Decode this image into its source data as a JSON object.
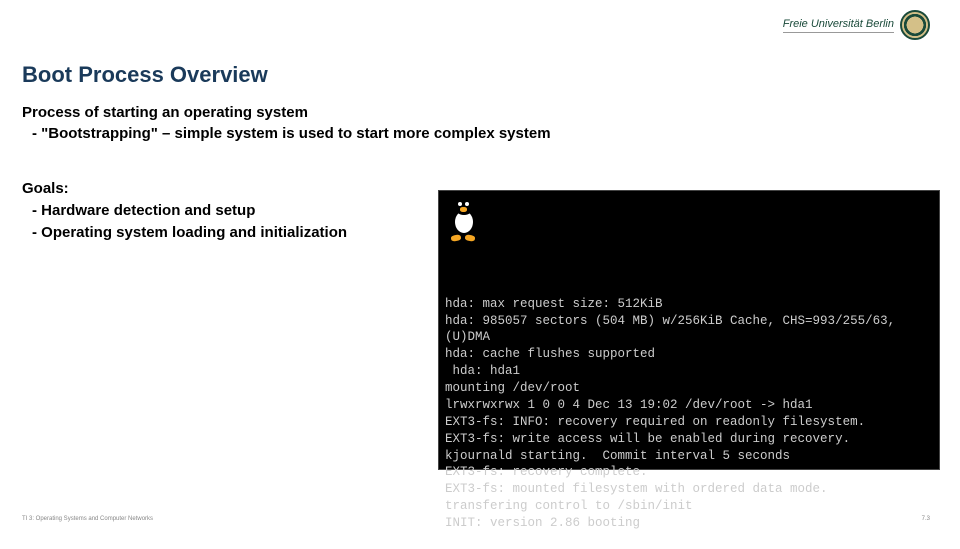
{
  "header": {
    "university_text": "Freie Universität Berlin",
    "seal_name": "university-seal"
  },
  "title": "Boot Process Overview",
  "intro": {
    "line1": "Process of starting an operating system",
    "line2": "- \"Bootstrapping\" – simple system is used to start more complex system"
  },
  "goals": {
    "heading": "Goals:",
    "item1": "- Hardware detection and setup",
    "item2": "- Operating system loading and initialization"
  },
  "terminal": {
    "icon": "tux-penguin",
    "lines": "hda: max request size: 512KiB\nhda: 985057 sectors (504 MB) w/256KiB Cache, CHS=993/255/63, (U)DMA\nhda: cache flushes supported\n hda: hda1\nmounting /dev/root\nlrwxrwxrwx 1 0 0 4 Dec 13 19:02 /dev/root -> hda1\nEXT3-fs: INFO: recovery required on readonly filesystem.\nEXT3-fs: write access will be enabled during recovery.\nkjournald starting.  Commit interval 5 seconds\nEXT3-fs: recovery complete.\nEXT3-fs: mounted filesystem with ordered data mode.\ntransfering control to /sbin/init\nINIT: version 2.86 booting"
  },
  "footer": {
    "left": "TI 3: Operating Systems and Computer Networks",
    "right": "7.3"
  }
}
